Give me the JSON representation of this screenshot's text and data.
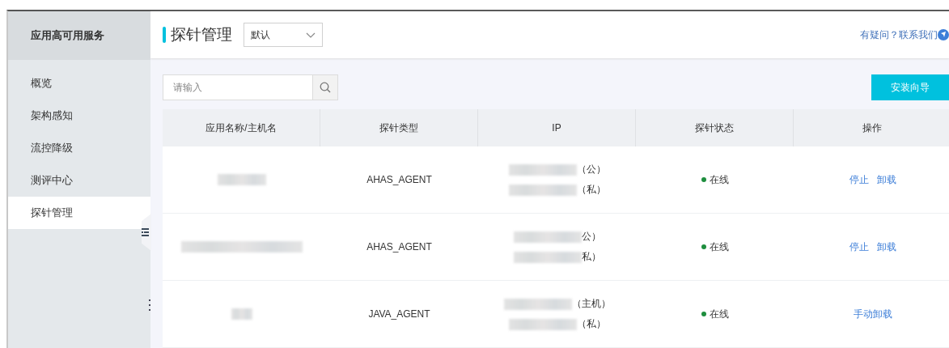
{
  "sidebar": {
    "title": "应用高可用服务",
    "items": [
      {
        "label": "概览",
        "selected": false
      },
      {
        "label": "架构感知",
        "selected": false
      },
      {
        "label": "流控降级",
        "selected": false
      },
      {
        "label": "测评中心",
        "selected": false
      },
      {
        "label": "探针管理",
        "selected": true
      }
    ]
  },
  "header": {
    "title": "探针管理",
    "namespace": {
      "value": "默认"
    },
    "help_link": "有疑问？联系我们"
  },
  "toolbar": {
    "search": {
      "placeholder": "请输入"
    },
    "install_button": "安装向导"
  },
  "table": {
    "columns": [
      "应用名称/主机名",
      "探针类型",
      "IP",
      "探针状态",
      "操作"
    ],
    "rows": [
      {
        "name_redacted": true,
        "probe_type": "AHAS_AGENT",
        "ips": [
          {
            "label": "（公）",
            "redacted": true
          },
          {
            "label": "（私）",
            "redacted": true
          }
        ],
        "status": {
          "label": "在线",
          "color": "#1e8e3e"
        },
        "actions": [
          "停止",
          "卸载"
        ]
      },
      {
        "name_redacted": true,
        "probe_type": "AHAS_AGENT",
        "ips": [
          {
            "label": "公）",
            "redacted": true
          },
          {
            "label": "私）",
            "redacted": true
          }
        ],
        "status": {
          "label": "在线",
          "color": "#1e8e3e"
        },
        "actions": [
          "停止",
          "卸载"
        ]
      },
      {
        "name_redacted": true,
        "probe_type": "JAVA_AGENT",
        "ips": [
          {
            "label": "（主机）",
            "redacted": true
          },
          {
            "label": "（私）",
            "redacted": true
          }
        ],
        "status": {
          "label": "在线",
          "color": "#1e8e3e"
        },
        "actions": [
          "手动卸载"
        ]
      }
    ]
  }
}
